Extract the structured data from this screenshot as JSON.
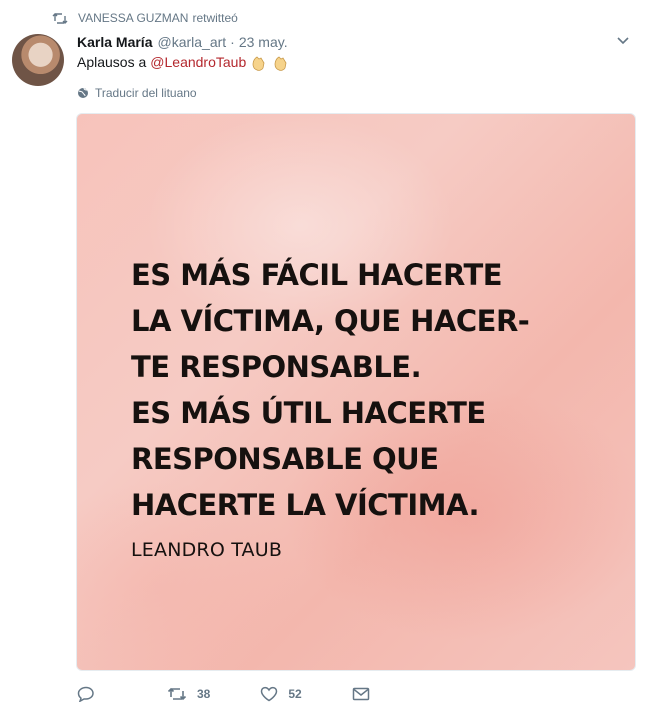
{
  "retweet_context": {
    "icon": "retweet-icon",
    "user": "VANESSA GUZMAN",
    "action": "retwitteó"
  },
  "tweet": {
    "author_name": "Karla María",
    "handle": "@karla_art",
    "separator": "·",
    "time": "23 may.",
    "text_prefix": "Aplausos a",
    "mention": "@LeandroTaub",
    "emoji": [
      "clapping-hands-icon",
      "clapping-hands-icon"
    ],
    "translate_label": "Traducir del lituano",
    "media": {
      "quote_lines": [
        "ES MÁS FÁCIL HACERTE",
        "LA VÍCTIMA, QUE HACER-",
        "TE RESPONSABLE.",
        "ES MÁS ÚTIL HACERTE",
        "RESPONSABLE QUE",
        "HACERTE LA VÍCTIMA."
      ],
      "author": "LEANDRO TAUB"
    },
    "actions": {
      "reply_count": "",
      "retweet_count": "38",
      "like_count": "52"
    }
  }
}
